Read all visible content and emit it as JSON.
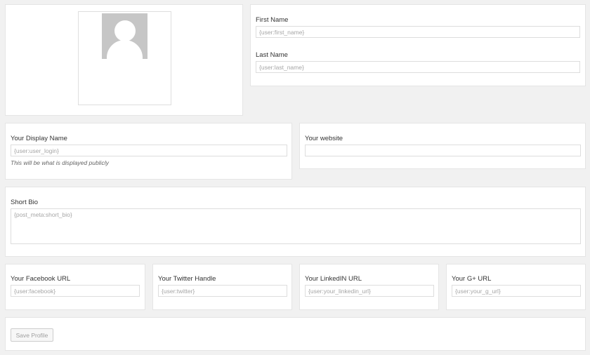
{
  "profile": {
    "avatar_alt": "default user avatar",
    "first_name_label": "First Name",
    "first_name_value": "{user:first_name}",
    "last_name_label": "Last Name",
    "last_name_value": "{user:last_name}"
  },
  "display": {
    "display_name_label": "Your Display Name",
    "display_name_value": "{user:user_login}",
    "display_name_hint": "This will be what is displayed publicly",
    "website_label": "Your website",
    "website_value": ""
  },
  "bio": {
    "label": "Short Bio",
    "value": "{post_meta:short_bio}"
  },
  "social": {
    "facebook_label": "Your Facebook URL",
    "facebook_value": "{user:facebook}",
    "twitter_label": "Your Twitter Handle",
    "twitter_value": "{user:twitter}",
    "linkedin_label": "Your LinkedIN URL",
    "linkedin_value": "{user:your_linkedin_url}",
    "gplus_label": "Your G+ URL",
    "gplus_value": "{user:your_g_url}"
  },
  "actions": {
    "save_label": "Save Profile"
  }
}
